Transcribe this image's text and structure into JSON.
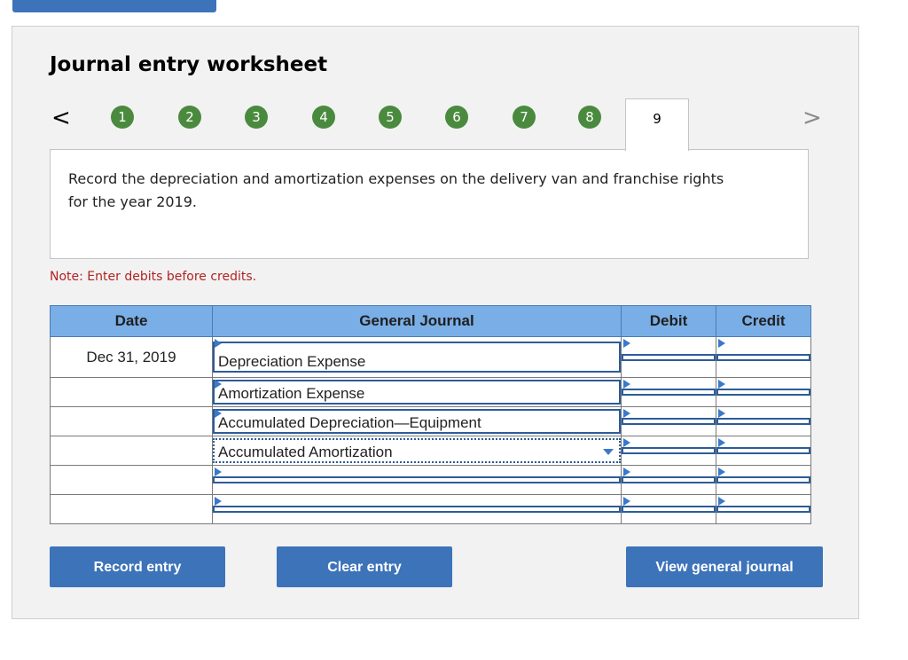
{
  "title": "Journal entry worksheet",
  "nav": {
    "prev_symbol": "<",
    "next_symbol": ">",
    "steps": [
      "1",
      "2",
      "3",
      "4",
      "5",
      "6",
      "7",
      "8"
    ],
    "active_step": "9"
  },
  "instruction": "Record the depreciation and amortization expenses on the delivery van and franchise rights for the year 2019.",
  "note": "Note: Enter debits before credits.",
  "table": {
    "headers": {
      "date": "Date",
      "journal": "General Journal",
      "debit": "Debit",
      "credit": "Credit"
    },
    "rows": [
      {
        "date": "Dec 31, 2019",
        "account": "Depreciation Expense",
        "debit": "",
        "credit": ""
      },
      {
        "date": "",
        "account": "Amortization Expense",
        "debit": "",
        "credit": ""
      },
      {
        "date": "",
        "account": "Accumulated Depreciation—Equipment",
        "debit": "",
        "credit": ""
      },
      {
        "date": "",
        "account": "Accumulated Amortization",
        "debit": "",
        "credit": ""
      },
      {
        "date": "",
        "account": "",
        "debit": "",
        "credit": ""
      },
      {
        "date": "",
        "account": "",
        "debit": "",
        "credit": ""
      }
    ]
  },
  "buttons": {
    "record": "Record entry",
    "clear": "Clear entry",
    "view": "View general journal"
  },
  "colors": {
    "accent": "#3d73b9",
    "step_complete": "#4a8a3e",
    "header_bg": "#7aaee6",
    "note": "#b22222"
  }
}
